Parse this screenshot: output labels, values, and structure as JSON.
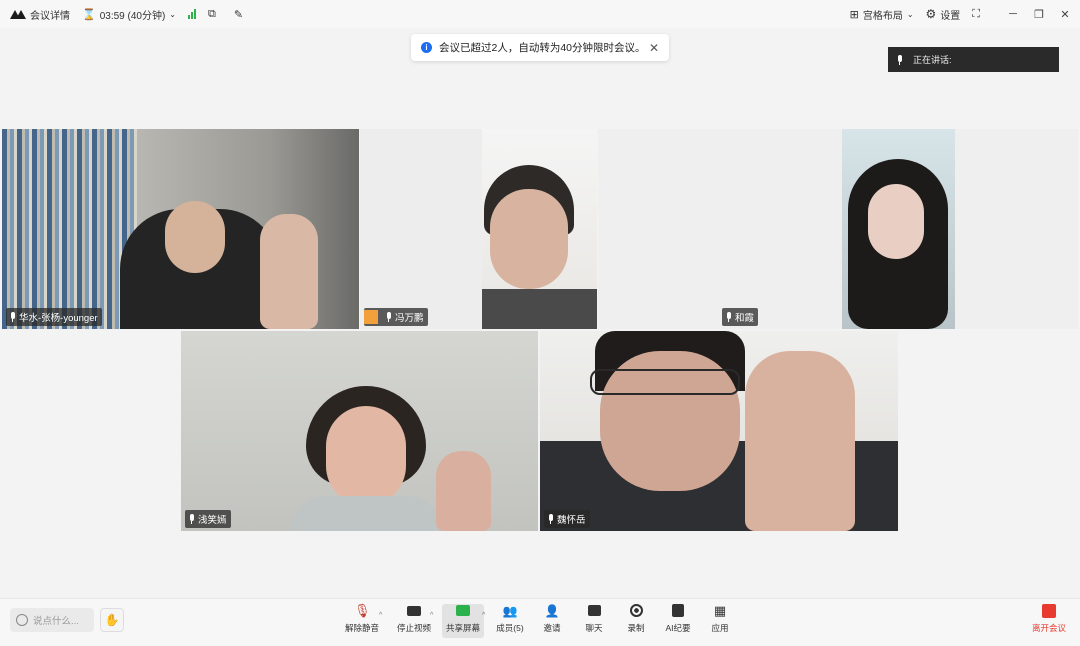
{
  "topbar": {
    "meeting_details": "会议详情",
    "timer": "03:59 (40分钟)",
    "layout_label": "宫格布局",
    "settings_label": "设置"
  },
  "notice": {
    "text": "会议已超过2人，自动转为40分钟限时会议。"
  },
  "speaking": {
    "label": "正在讲话:"
  },
  "participants": [
    {
      "name": "华水-张杨-younger"
    },
    {
      "name": "冯万鹏"
    },
    {
      "name": "和霞"
    },
    {
      "name": "浅笑嫣"
    },
    {
      "name": "魏怀岳"
    }
  ],
  "toolbar": {
    "chat_placeholder": "说点什么...",
    "unmute": "解除静音",
    "stop_video": "停止视频",
    "share_screen": "共享屏幕",
    "members": "成员(5)",
    "invite": "邀请",
    "chat": "聊天",
    "record": "录制",
    "ai_summary": "AI纪要",
    "apps": "应用",
    "leave": "离开会议"
  },
  "colors": {
    "accent_blue": "#1b6ef3",
    "signal_green": "#2bb24c",
    "leave_red": "#e63b2e"
  }
}
